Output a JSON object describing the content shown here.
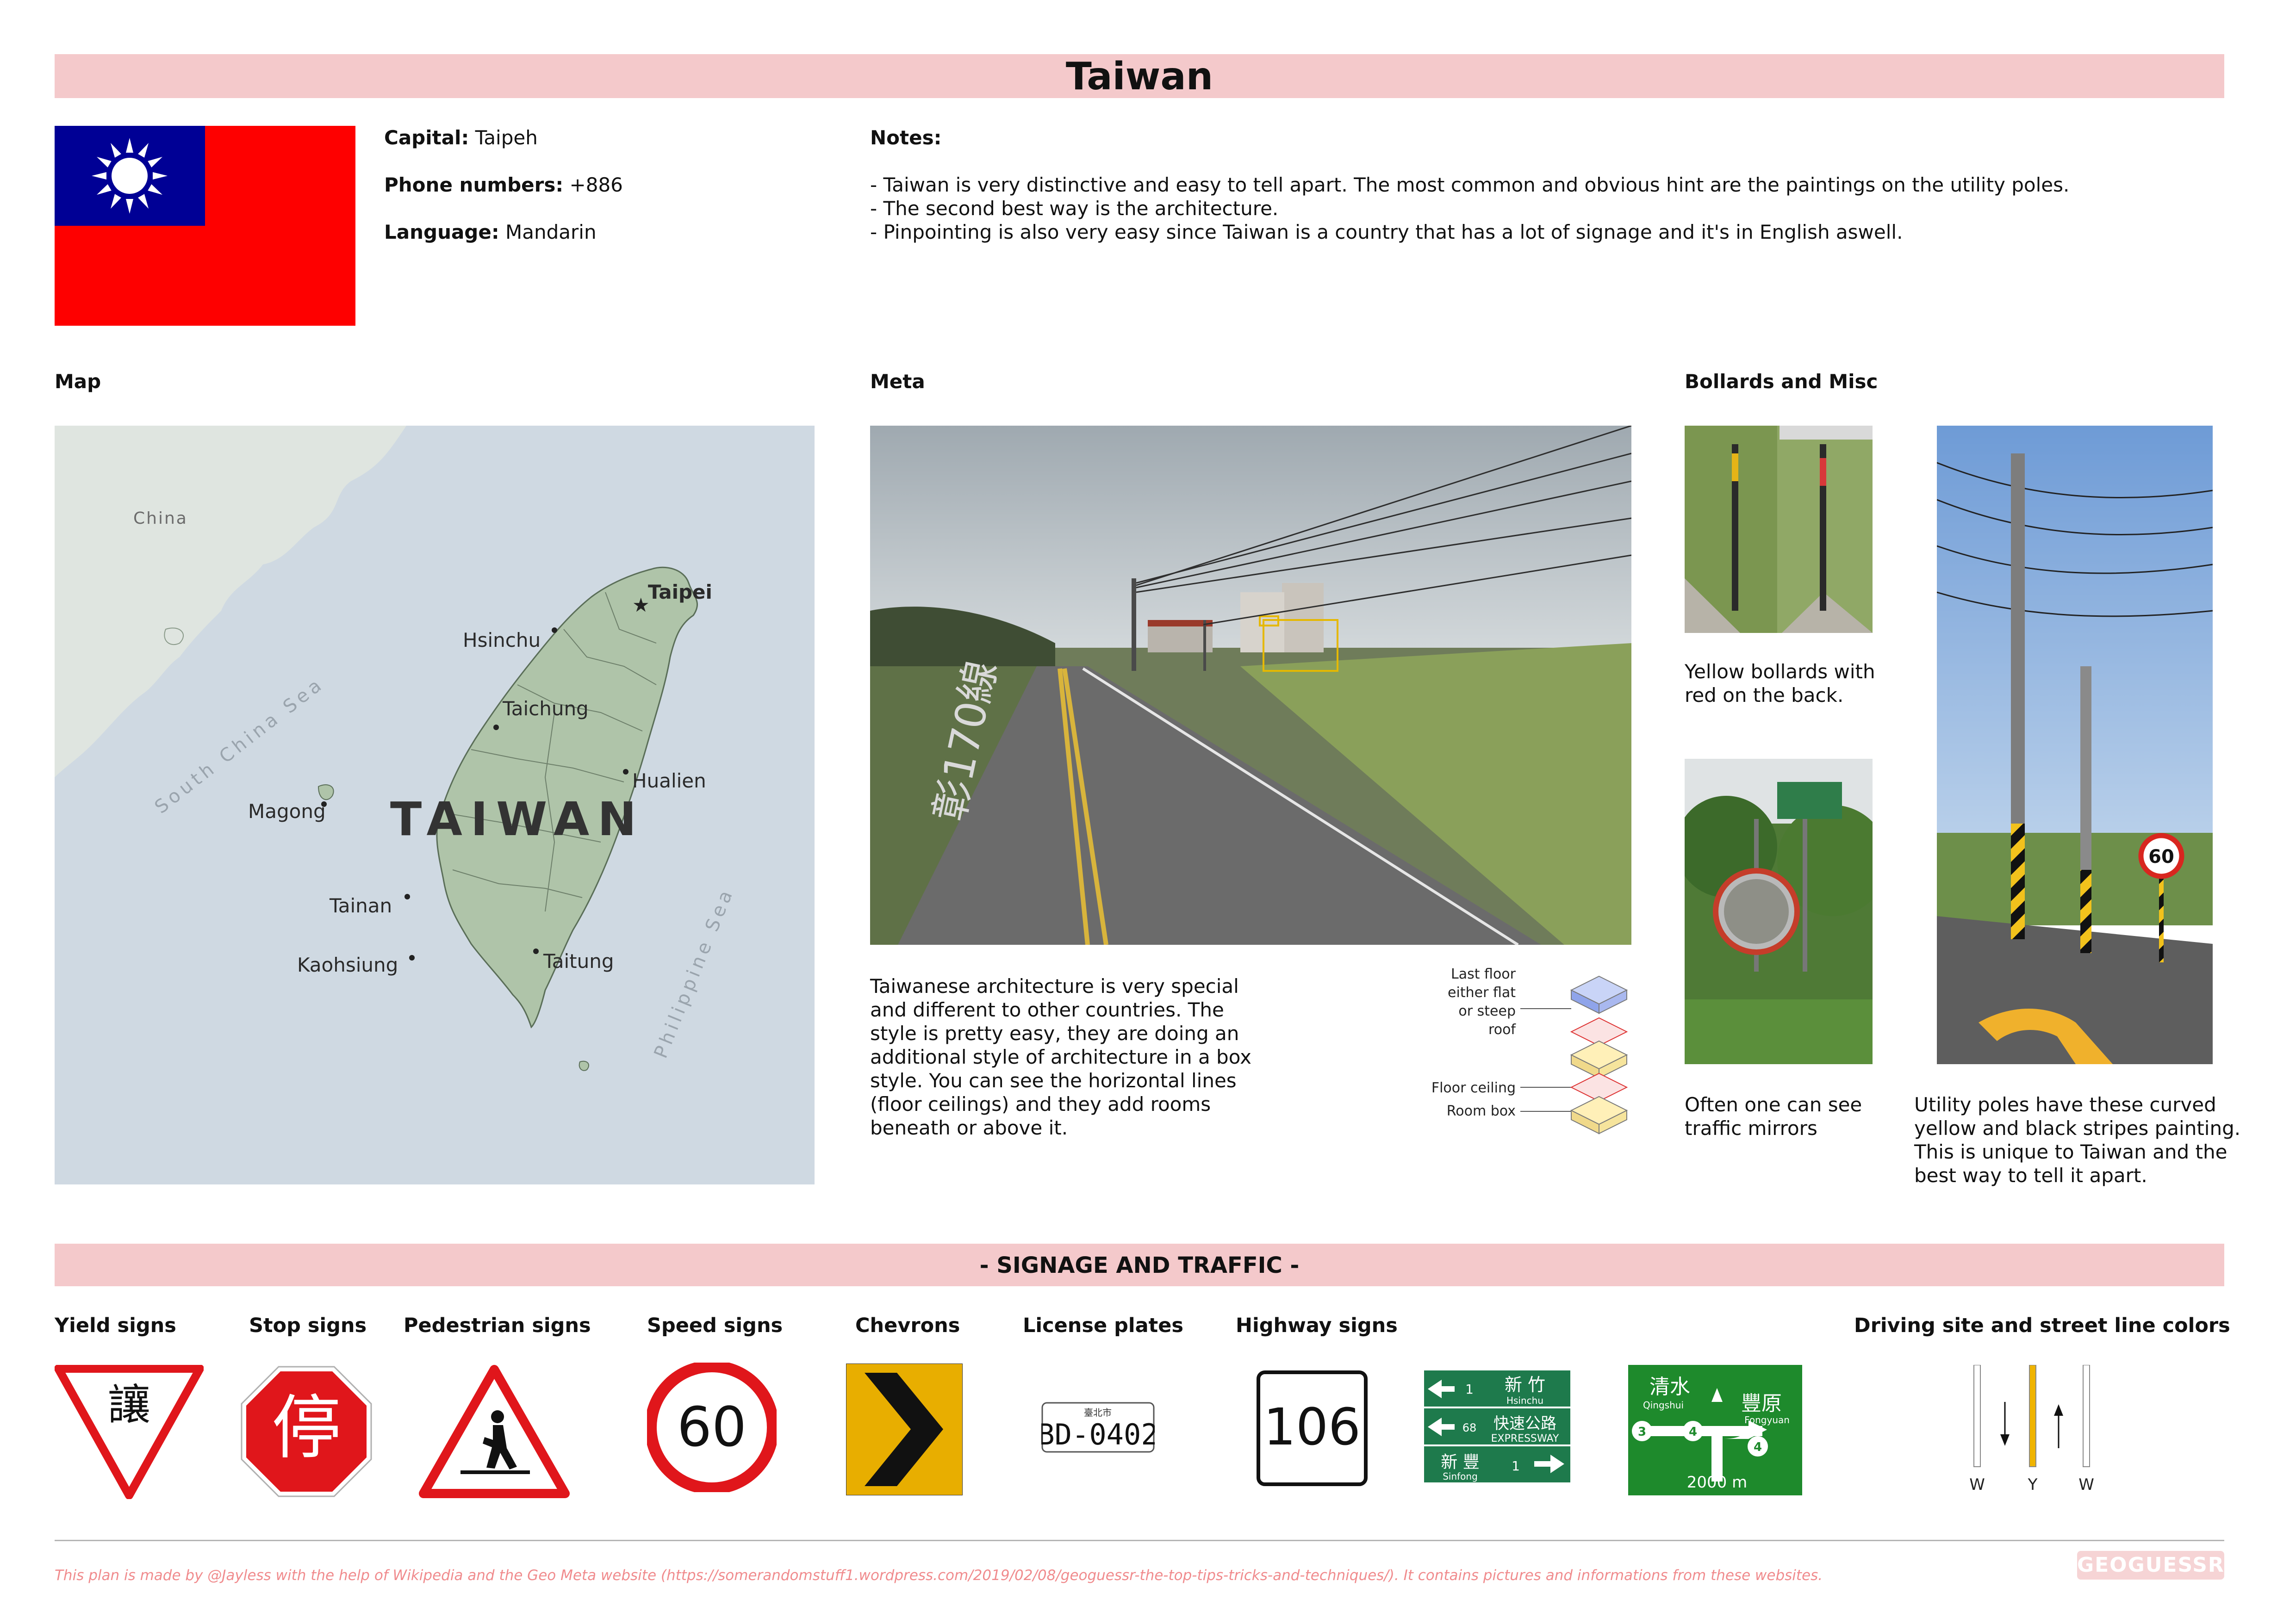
{
  "title": "Taiwan",
  "info": {
    "capital_label": "Capital:",
    "capital": "Taipeh",
    "phone_label": "Phone numbers:",
    "phone": "+886",
    "language_label": "Language:",
    "language": "Mandarin"
  },
  "notes": {
    "heading": "Notes:",
    "lines": [
      "- Taiwan is very distinctive and easy to tell apart. The most common and obvious hint are the paintings on the utility poles.",
      "- The second best way is the architecture.",
      "- Pinpointing is also very easy since Taiwan is a country that has a lot of signage and it's in English aswell."
    ]
  },
  "sections": {
    "map": "Map",
    "meta": "Meta",
    "bollards": "Bollards and Misc"
  },
  "map": {
    "country_label": "TAIWAN",
    "sea_labels": [
      "South China Sea",
      "Philippine Sea"
    ],
    "neighbor": "China",
    "cities": [
      "Taipei",
      "Hsinchu",
      "Taichung",
      "Hualien",
      "Magong",
      "Tainan",
      "Kaohsiung",
      "Taitung"
    ]
  },
  "meta": {
    "road_text": "彰170線",
    "description": [
      "Taiwanese architecture is very special",
      "and different to other countries. The",
      "style is pretty easy, they are doing an",
      "additional style of architecture in a box",
      "style. You can see the horizontal lines",
      "(floor ceilings) and they add rooms",
      "beneath or above it."
    ],
    "diagram_labels": {
      "last_floor": [
        "Last floor",
        "either flat",
        "or steep",
        "roof"
      ],
      "floor_ceiling": "Floor ceiling",
      "room_box": "Room box"
    }
  },
  "bollards": {
    "caption1": [
      "Yellow bollards with",
      "red on the back."
    ],
    "caption2": [
      "Often one can see",
      "traffic mirrors"
    ],
    "caption3": [
      "Utility poles have these curved",
      "yellow and black stripes painting.",
      "This is unique to Taiwan and the",
      "best way to tell it apart."
    ],
    "speed_value": "60"
  },
  "signage": {
    "heading": "- SIGNAGE AND TRAFFIC -",
    "labels": {
      "yield": "Yield signs",
      "stop": "Stop signs",
      "pedestrian": "Pedestrian signs",
      "speed": "Speed signs",
      "chevrons": "Chevrons",
      "plates": "License plates",
      "highway": "Highway signs",
      "driving": "Driving site and street line colors"
    },
    "yield_char": "讓",
    "stop_char": "停",
    "speed_value": "60",
    "plate_top": "臺北市",
    "plate_text": "BD-0402",
    "highway_number": "106",
    "guide_sign": {
      "row1_num": "1",
      "row1_zh": "新 竹",
      "row1_en": "Hsinchu",
      "row2_num": "68",
      "row2_zh": "快速公路",
      "row2_en": "EXPRESSWAY",
      "row3_zh": "新 豐",
      "row3_en": "Sinfong",
      "row3_num": "1"
    },
    "direction_sign": {
      "left_zh": "清水",
      "left_en": "Qingshui",
      "right_zh": "豐原",
      "right_en": "Fongyuan",
      "num_left": "3",
      "num_mid": "4",
      "num_right": "4",
      "distance": "2000 m"
    },
    "line_colors": [
      "W",
      "Y",
      "W"
    ]
  },
  "footer": "This plan is made by @Jayless with the help of Wikipedia and the Geo Meta website (https://somerandomstuff1.wordpress.com/2019/02/08/geoguessr-the-top-tips-tricks-and-techniques/). It contains pictures and informations from these websites.",
  "logo": "GEOGUESSR",
  "colors": {
    "banner": "#f4c9cb",
    "flag_red": "#fe0000",
    "flag_blue": "#000095",
    "sign_red": "#e0161b",
    "footer": "#f08b8d"
  }
}
